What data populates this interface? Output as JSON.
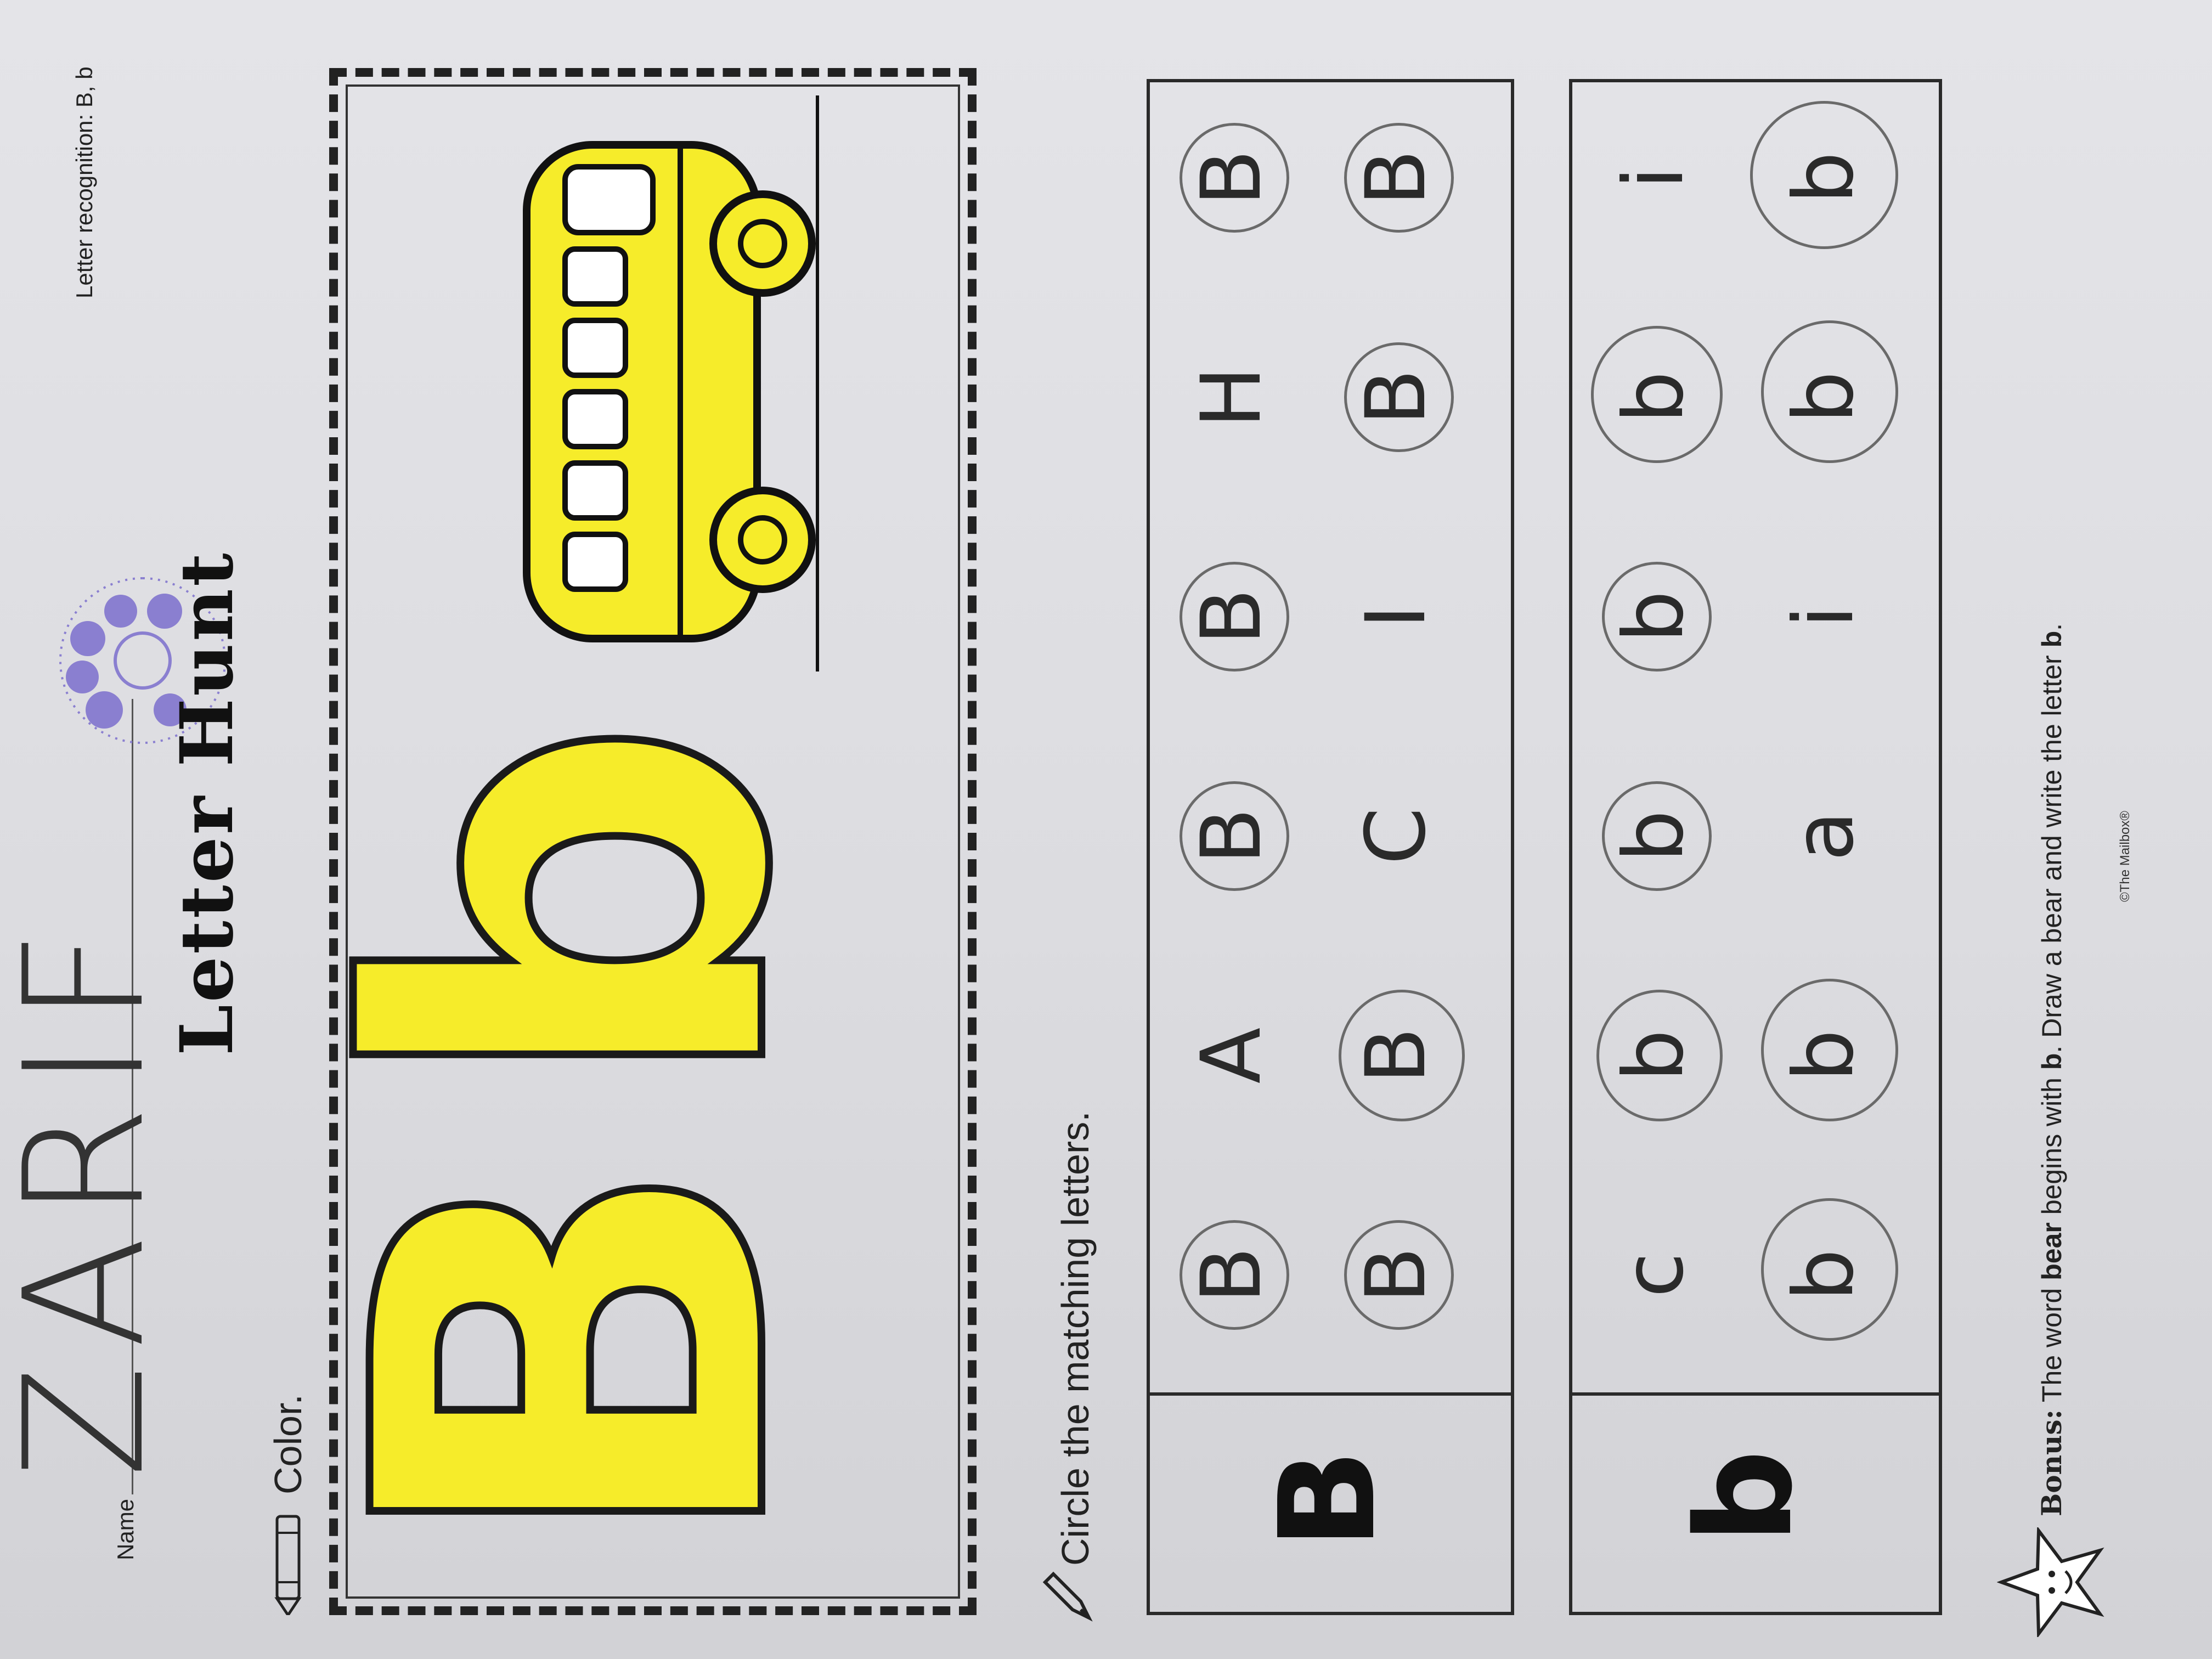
{
  "header": {
    "name_label": "Name",
    "student_name": "ZARIF",
    "title": "Letter Hunt",
    "subject": "Letter recognition: B, b"
  },
  "color_section": {
    "instruction": "Color.",
    "letters": [
      "B",
      "b"
    ]
  },
  "circle_section": {
    "instruction": "Circle the matching letters.",
    "rows": [
      {
        "target": "B",
        "grid": [
          [
            "B",
            "A",
            "B",
            "B",
            "H",
            "B"
          ],
          [
            "B",
            "B",
            "C",
            "I",
            "B",
            "B"
          ]
        ]
      },
      {
        "target": "b",
        "grid": [
          [
            "c",
            "b",
            "b",
            "b",
            "b",
            "i"
          ],
          [
            "b",
            "b",
            "a",
            "i",
            "b",
            "b"
          ]
        ]
      }
    ]
  },
  "bonus": {
    "label": "Bonus:",
    "text_1": " The word ",
    "bold_word": "bear",
    "text_2": " begins with ",
    "bold_letter": "b",
    "text_3": ". Draw a bear and write the letter ",
    "bold_letter_2": "b",
    "text_4": "."
  },
  "footer": {
    "copyright": "©The Mailbox®"
  },
  "colors": {
    "crayon_yellow": "#f6ec2a",
    "ink": "#222222",
    "logo_purple": "#8a7fd0"
  }
}
